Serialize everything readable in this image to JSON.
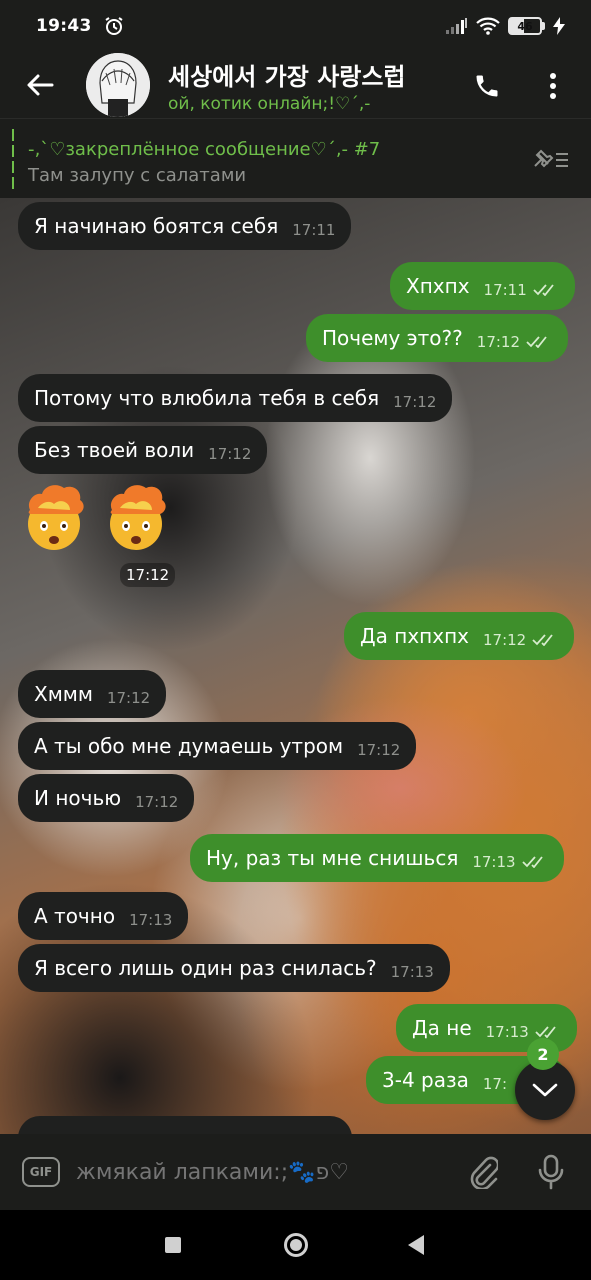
{
  "status_bar": {
    "time": "19:43",
    "battery": "46"
  },
  "header": {
    "title": "세상에서 가장 사랑스럽",
    "status": "ой, котик онлайн;!♡´‚-"
  },
  "pinned": {
    "title": "-‚`♡закреплённое сообщение♡´‚- #7",
    "text": "Там залупу с салатами"
  },
  "messages": [
    {
      "text": "Я начинаю боятся себя",
      "time": "17:11"
    },
    {
      "text": "Хпхпх",
      "time": "17:11"
    },
    {
      "text": "Почему это??",
      "time": "17:12"
    },
    {
      "text": "Потому что влюбила тебя в себя",
      "time": "17:12"
    },
    {
      "text": "Без твоей воли",
      "time": "17:12"
    },
    {
      "text": "🤯🤯",
      "time": "17:12"
    },
    {
      "text": "Да пхпхпх",
      "time": "17:12"
    },
    {
      "text": "Хммм",
      "time": "17:12"
    },
    {
      "text": "А ты обо мне думаешь утром",
      "time": "17:12"
    },
    {
      "text": "И ночью",
      "time": "17:12"
    },
    {
      "text": "Ну, раз ты мне снишься",
      "time": "17:13"
    },
    {
      "text": "А точно",
      "time": "17:13"
    },
    {
      "text": "Я всего лишь один раз снилась?",
      "time": "17:13"
    },
    {
      "text": "Да не",
      "time": "17:13"
    },
    {
      "text": "3-4 раза",
      "time": "17:"
    }
  ],
  "scroll_badge": "2",
  "composer": {
    "gif_label": "GIF",
    "placeholder": "жмякай лапками:;🐾פ♡"
  }
}
